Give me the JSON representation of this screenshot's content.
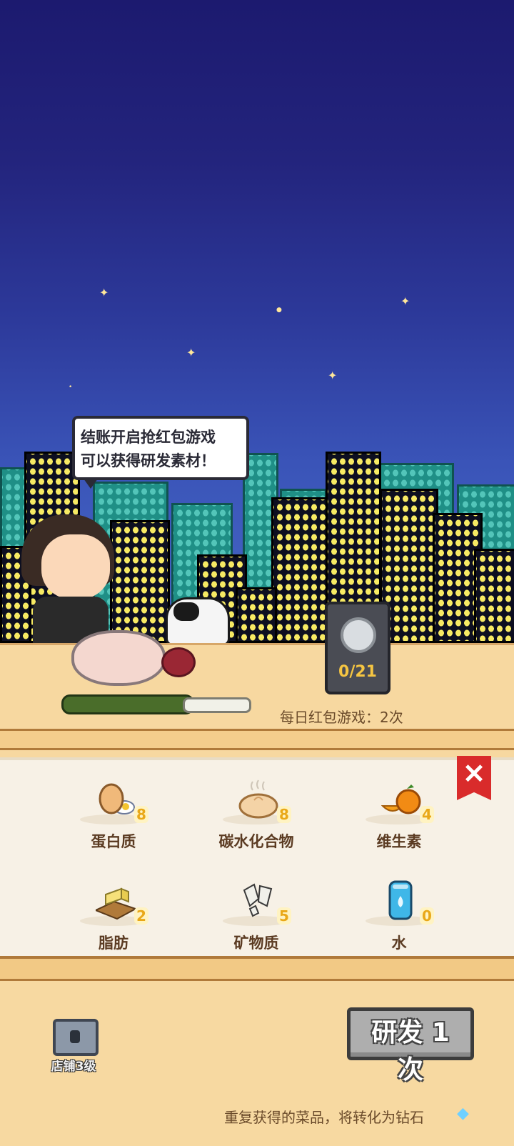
{
  "speech_bubble": {
    "line1": "结账开启抢红包游戏",
    "line2": "可以获得研发素材！"
  },
  "medal": {
    "progress": "0/21",
    "value": 0,
    "total": 21
  },
  "daily_game": "每日红包游戏：2次",
  "nutrients": [
    {
      "label": "蛋白质",
      "count": "8",
      "icon": "egg-icon"
    },
    {
      "label": "碳水化合物",
      "count": "8",
      "icon": "steamed-bun-icon"
    },
    {
      "label": "维生素",
      "count": "4",
      "icon": "orange-icon"
    },
    {
      "label": "脂肪",
      "count": "2",
      "icon": "butter-icon"
    },
    {
      "label": "矿物质",
      "count": "5",
      "icon": "salt-icon"
    },
    {
      "label": "水",
      "count": "0",
      "icon": "water-can-icon"
    }
  ],
  "close_button": "✕",
  "shop_lock_label": "店铺3级",
  "research_button": "研发 1 次",
  "footer_note": "重复获得的菜品，将转化为钻石",
  "colors": {
    "sky_top": "#1c1a6f",
    "sky_bottom": "#4768c6",
    "accent_count": "#e9a818",
    "close_red": "#d92b2b"
  }
}
